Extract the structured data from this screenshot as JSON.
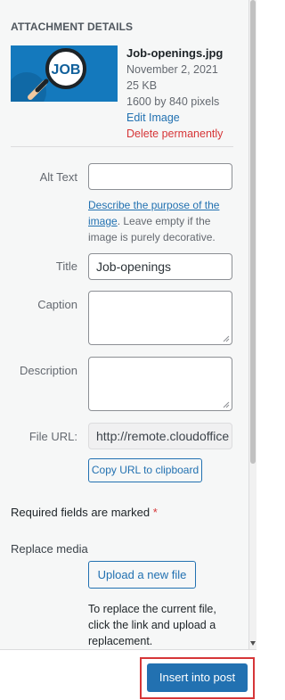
{
  "heading": "Attachment Details",
  "attachment": {
    "thumbnail_text": "JOB",
    "filename": "Job-openings.jpg",
    "date": "November 2, 2021",
    "size": "25 KB",
    "dimensions": "1600 by 840 pixels",
    "edit_link": "Edit Image",
    "delete_link": "Delete permanently"
  },
  "fields": {
    "alt_text_label": "Alt Text",
    "alt_text_value": "",
    "alt_help_link": "Describe the purpose of the image",
    "alt_help_rest": ". Leave empty if the image is purely decorative.",
    "title_label": "Title",
    "title_value": "Job-openings",
    "caption_label": "Caption",
    "caption_value": "",
    "description_label": "Description",
    "description_value": "",
    "file_url_label": "File URL:",
    "file_url_value": "http://remote.cloudoffice",
    "copy_url_button": "Copy URL to clipboard"
  },
  "required_note": "Required fields are marked",
  "required_star": "*",
  "replace": {
    "label": "Replace media",
    "button": "Upload a new file",
    "help": "To replace the current file, click the link and upload a replacement."
  },
  "footer": {
    "insert_button": "Insert into post"
  },
  "colors": {
    "link": "#2271b1",
    "danger": "#d63638",
    "primary": "#2271b1"
  }
}
